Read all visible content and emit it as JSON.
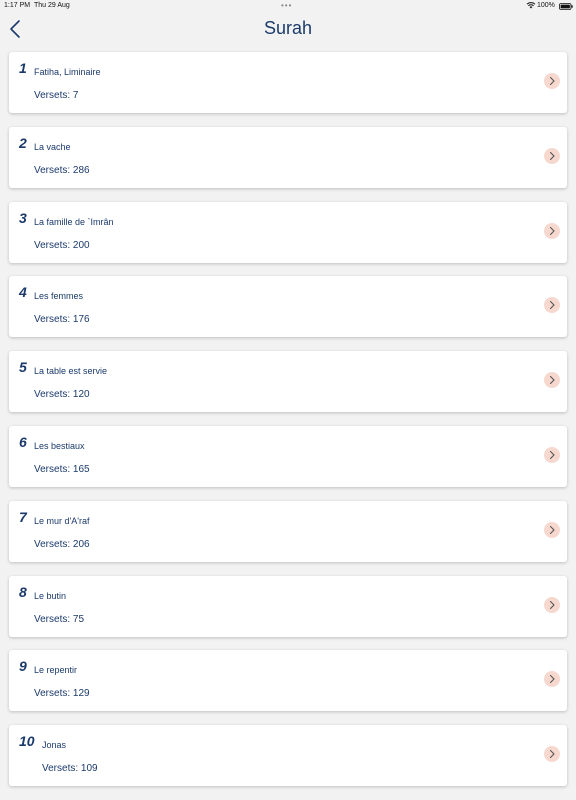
{
  "status_bar": {
    "time": "1:17 PM",
    "date": "Thu 29 Aug",
    "battery_text": "100%"
  },
  "header": {
    "title": "Surah"
  },
  "colors": {
    "accent": "#1b3a6b",
    "chevron_bg": "#f6d8cf",
    "background": "#f2f2f2"
  },
  "surahs": [
    {
      "number": "1",
      "name": "Fatiha, Liminaire",
      "verses": "Versets: 7"
    },
    {
      "number": "2",
      "name": "La vache",
      "verses": "Versets: 286"
    },
    {
      "number": "3",
      "name": "La famille de `Imrân",
      "verses": "Versets: 200"
    },
    {
      "number": "4",
      "name": "Les femmes",
      "verses": "Versets: 176"
    },
    {
      "number": "5",
      "name": "La table est servie",
      "verses": "Versets: 120"
    },
    {
      "number": "6",
      "name": "Les bestiaux",
      "verses": "Versets: 165"
    },
    {
      "number": "7",
      "name": "Le mur d'A'raf",
      "verses": "Versets: 206"
    },
    {
      "number": "8",
      "name": "Le butin",
      "verses": "Versets: 75"
    },
    {
      "number": "9",
      "name": "Le repentir",
      "verses": "Versets: 129"
    },
    {
      "number": "10",
      "name": "Jonas",
      "verses": "Versets: 109"
    }
  ]
}
